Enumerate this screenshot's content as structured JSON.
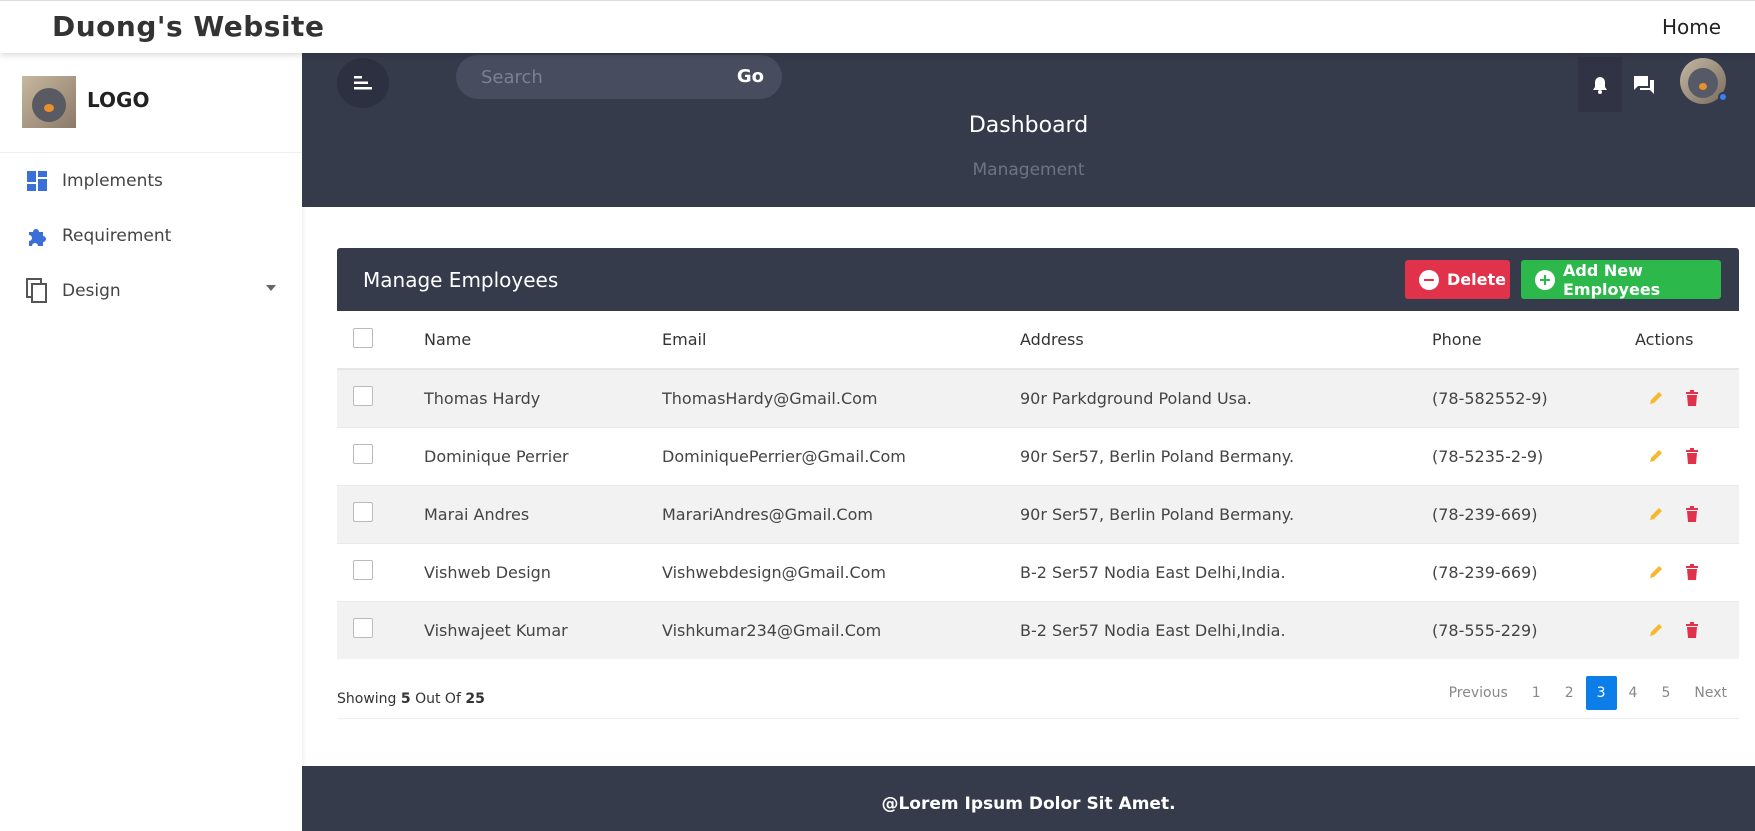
{
  "topnav": {
    "site_title": "Duong's Website",
    "home": "Home"
  },
  "sidebar": {
    "logo_text": "LOGO",
    "items": [
      {
        "label": "Implements",
        "icon": "dashboard-icon"
      },
      {
        "label": "Requirement",
        "icon": "puzzle-icon"
      },
      {
        "label": "Design",
        "icon": "copy-icon"
      }
    ]
  },
  "header": {
    "search_placeholder": "Search",
    "go_label": "Go",
    "title": "Dashboard",
    "subtitle": "Management"
  },
  "panel": {
    "title": "Manage Employees",
    "delete_label": "Delete",
    "add_label": "Add New Employees",
    "columns": [
      "Name",
      "Email",
      "Address",
      "Phone",
      "Actions"
    ],
    "rows": [
      {
        "name": "Thomas Hardy",
        "email": "ThomasHardy@Gmail.Com",
        "address": "90r Parkdground Poland Usa.",
        "phone": "(78-582552-9)"
      },
      {
        "name": "Dominique Perrier",
        "email": "DominiquePerrier@Gmail.Com",
        "address": "90r Ser57, Berlin Poland Bermany.",
        "phone": "(78-5235-2-9)"
      },
      {
        "name": "Marai Andres",
        "email": "MarariAndres@Gmail.Com",
        "address": "90r Ser57, Berlin Poland Bermany.",
        "phone": "(78-239-669)"
      },
      {
        "name": "Vishweb Design",
        "email": "Vishwebdesign@Gmail.Com",
        "address": "B-2 Ser57 Nodia East Delhi,India.",
        "phone": "(78-239-669)"
      },
      {
        "name": "Vishwajeet Kumar",
        "email": "Vishkumar234@Gmail.Com",
        "address": "B-2 Ser57 Nodia East Delhi,India.",
        "phone": "(78-555-229)"
      }
    ],
    "showing": {
      "prefix": "Showing",
      "count": "5",
      "middle": "Out Of",
      "total": "25"
    },
    "pagination": {
      "previous": "Previous",
      "pages": [
        "1",
        "2",
        "3",
        "4",
        "5"
      ],
      "active_page": "3",
      "next": "Next"
    }
  },
  "footer": {
    "text": "@Lorem Ipsum Dolor Sit Amet."
  },
  "colors": {
    "header_bg": "#363b4c",
    "delete": "#e0324a",
    "add": "#2db84c",
    "edit_icon": "#f5b82e",
    "trash_icon": "#e0324a",
    "active_page": "#0d7de8",
    "sidebar_icon": "#3a6fd8"
  }
}
